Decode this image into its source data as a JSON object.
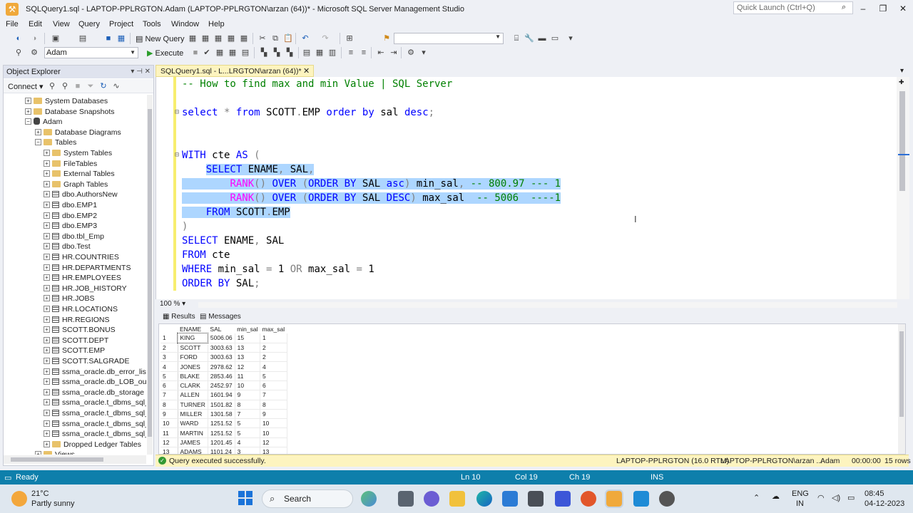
{
  "window": {
    "title": "SQLQuery1.sql - LAPTOP-PPLRGTON.Adam (LAPTOP-PPLRGTON\\arzan (64))* - Microsoft SQL Server Management Studio",
    "quick_launch_placeholder": "Quick Launch (Ctrl+Q)",
    "controls": [
      "–",
      "❐",
      "✕"
    ]
  },
  "menu": [
    "File",
    "Edit",
    "View",
    "Query",
    "Project",
    "Tools",
    "Window",
    "Help"
  ],
  "toolbar": {
    "new_query_label": "New Query",
    "database_selected": "Adam",
    "execute_label": "Execute"
  },
  "object_explorer": {
    "title": "Object Explorer",
    "connect_label": "Connect ▾",
    "tree": [
      {
        "label": "System Databases",
        "depth": 2,
        "icon": "folder",
        "expander": "+"
      },
      {
        "label": "Database Snapshots",
        "depth": 2,
        "icon": "folder",
        "expander": "+"
      },
      {
        "label": "Adam",
        "depth": 2,
        "icon": "database",
        "expander": "−"
      },
      {
        "label": "Database Diagrams",
        "depth": 3,
        "icon": "folder",
        "expander": "+"
      },
      {
        "label": "Tables",
        "depth": 3,
        "icon": "folder",
        "expander": "−"
      },
      {
        "label": "System Tables",
        "depth": 4,
        "icon": "folder",
        "expander": "+"
      },
      {
        "label": "FileTables",
        "depth": 4,
        "icon": "folder",
        "expander": "+"
      },
      {
        "label": "External Tables",
        "depth": 4,
        "icon": "folder",
        "expander": "+"
      },
      {
        "label": "Graph Tables",
        "depth": 4,
        "icon": "folder",
        "expander": "+"
      },
      {
        "label": "dbo.AuthorsNew",
        "depth": 4,
        "icon": "table",
        "expander": "+"
      },
      {
        "label": "dbo.EMP1",
        "depth": 4,
        "icon": "table",
        "expander": "+"
      },
      {
        "label": "dbo.EMP2",
        "depth": 4,
        "icon": "table",
        "expander": "+"
      },
      {
        "label": "dbo.EMP3",
        "depth": 4,
        "icon": "table",
        "expander": "+"
      },
      {
        "label": "dbo.tbl_Emp",
        "depth": 4,
        "icon": "table",
        "expander": "+"
      },
      {
        "label": "dbo.Test",
        "depth": 4,
        "icon": "table",
        "expander": "+"
      },
      {
        "label": "HR.COUNTRIES",
        "depth": 4,
        "icon": "table",
        "expander": "+"
      },
      {
        "label": "HR.DEPARTMENTS",
        "depth": 4,
        "icon": "table",
        "expander": "+"
      },
      {
        "label": "HR.EMPLOYEES",
        "depth": 4,
        "icon": "table",
        "expander": "+"
      },
      {
        "label": "HR.JOB_HISTORY",
        "depth": 4,
        "icon": "table",
        "expander": "+"
      },
      {
        "label": "HR.JOBS",
        "depth": 4,
        "icon": "table",
        "expander": "+"
      },
      {
        "label": "HR.LOCATIONS",
        "depth": 4,
        "icon": "table",
        "expander": "+"
      },
      {
        "label": "HR.REGIONS",
        "depth": 4,
        "icon": "table",
        "expander": "+"
      },
      {
        "label": "SCOTT.BONUS",
        "depth": 4,
        "icon": "table",
        "expander": "+"
      },
      {
        "label": "SCOTT.DEPT",
        "depth": 4,
        "icon": "table",
        "expander": "+"
      },
      {
        "label": "SCOTT.EMP",
        "depth": 4,
        "icon": "table",
        "expander": "+"
      },
      {
        "label": "SCOTT.SALGRADE",
        "depth": 4,
        "icon": "table",
        "expander": "+"
      },
      {
        "label": "ssma_oracle.db_error_list",
        "depth": 4,
        "icon": "table",
        "expander": "+"
      },
      {
        "label": "ssma_oracle.db_LOB_outp",
        "depth": 4,
        "icon": "table",
        "expander": "+"
      },
      {
        "label": "ssma_oracle.db_storage",
        "depth": 4,
        "icon": "table",
        "expander": "+"
      },
      {
        "label": "ssma_oracle.t_dbms_sql_b",
        "depth": 4,
        "icon": "table",
        "expander": "+"
      },
      {
        "label": "ssma_oracle.t_dbms_sql_c",
        "depth": 4,
        "icon": "table",
        "expander": "+"
      },
      {
        "label": "ssma_oracle.t_dbms_sql_d",
        "depth": 4,
        "icon": "table",
        "expander": "+"
      },
      {
        "label": "ssma_oracle.t_dbms_sql_re",
        "depth": 4,
        "icon": "table",
        "expander": "+"
      },
      {
        "label": "Dropped Ledger Tables",
        "depth": 4,
        "icon": "folder",
        "expander": "+"
      },
      {
        "label": "Views",
        "depth": 3,
        "icon": "folder",
        "expander": "+"
      }
    ]
  },
  "editor": {
    "tab_label": "SQLQuery1.sql - L...LRGTON\\arzan (64))*",
    "zoom": "100 %",
    "lines": [
      [
        {
          "t": "-- How to find max and min Value | SQL Server",
          "c": "cm"
        }
      ],
      [],
      [
        {
          "t": "select",
          "c": "kw"
        },
        {
          "t": " ",
          "c": ""
        },
        {
          "t": "*",
          "c": "gr"
        },
        {
          "t": " ",
          "c": ""
        },
        {
          "t": "from",
          "c": "kw"
        },
        {
          "t": " SCOTT",
          "c": ""
        },
        {
          "t": ".",
          "c": "gr"
        },
        {
          "t": "EMP ",
          "c": ""
        },
        {
          "t": "order by",
          "c": "kw"
        },
        {
          "t": " sal ",
          "c": ""
        },
        {
          "t": "desc",
          "c": "kw"
        },
        {
          "t": ";",
          "c": "gr"
        }
      ],
      [],
      [],
      [
        {
          "t": "WITH",
          "c": "kw"
        },
        {
          "t": " cte ",
          "c": ""
        },
        {
          "t": "AS",
          "c": "kw"
        },
        {
          "t": " ",
          "c": ""
        },
        {
          "t": "(",
          "c": "gr"
        }
      ],
      [
        {
          "t": "    ",
          "c": ""
        },
        {
          "t": "SELECT",
          "c": "kw sel"
        },
        {
          "t": " ENAME",
          "c": "sel"
        },
        {
          "t": ",",
          "c": "gr sel"
        },
        {
          "t": " SAL",
          "c": "sel"
        },
        {
          "t": ",",
          "c": "gr sel"
        }
      ],
      [
        {
          "t": "        ",
          "c": "sel"
        },
        {
          "t": "RANK",
          "c": "fn sel"
        },
        {
          "t": "()",
          "c": "gr sel"
        },
        {
          "t": " ",
          "c": "sel"
        },
        {
          "t": "OVER",
          "c": "kw sel"
        },
        {
          "t": " ",
          "c": "sel"
        },
        {
          "t": "(",
          "c": "gr sel"
        },
        {
          "t": "ORDER BY",
          "c": "kw sel"
        },
        {
          "t": " SAL ",
          "c": "sel"
        },
        {
          "t": "asc",
          "c": "kw sel"
        },
        {
          "t": ")",
          "c": "gr sel"
        },
        {
          "t": " min_sal",
          "c": "sel"
        },
        {
          "t": ",",
          "c": "gr sel"
        },
        {
          "t": " -- 800.97 --- 1",
          "c": "cm sel"
        }
      ],
      [
        {
          "t": "        ",
          "c": "sel"
        },
        {
          "t": "RANK",
          "c": "fn sel"
        },
        {
          "t": "()",
          "c": "gr sel"
        },
        {
          "t": " ",
          "c": "sel"
        },
        {
          "t": "OVER",
          "c": "kw sel"
        },
        {
          "t": " ",
          "c": "sel"
        },
        {
          "t": "(",
          "c": "gr sel"
        },
        {
          "t": "ORDER BY",
          "c": "kw sel"
        },
        {
          "t": " SAL ",
          "c": "sel"
        },
        {
          "t": "DESC",
          "c": "kw sel"
        },
        {
          "t": ")",
          "c": "gr sel"
        },
        {
          "t": " max_sal  ",
          "c": "sel"
        },
        {
          "t": "-- 5006  ----1",
          "c": "cm sel"
        }
      ],
      [
        {
          "t": "    ",
          "c": "sel"
        },
        {
          "t": "FROM",
          "c": "kw sel"
        },
        {
          "t": " SCOTT",
          "c": "sel"
        },
        {
          "t": ".",
          "c": "gr sel"
        },
        {
          "t": "EMP",
          "c": "sel"
        }
      ],
      [
        {
          "t": ")",
          "c": "gr"
        }
      ],
      [
        {
          "t": "SELECT",
          "c": "kw"
        },
        {
          "t": " ENAME",
          "c": ""
        },
        {
          "t": ",",
          "c": "gr"
        },
        {
          "t": " SAL",
          "c": ""
        }
      ],
      [
        {
          "t": "FROM",
          "c": "kw"
        },
        {
          "t": " cte",
          "c": ""
        }
      ],
      [
        {
          "t": "WHERE",
          "c": "kw"
        },
        {
          "t": " min_sal ",
          "c": ""
        },
        {
          "t": "=",
          "c": "gr"
        },
        {
          "t": " 1 ",
          "c": ""
        },
        {
          "t": "OR",
          "c": "gr"
        },
        {
          "t": " max_sal ",
          "c": ""
        },
        {
          "t": "=",
          "c": "gr"
        },
        {
          "t": " 1",
          "c": ""
        }
      ],
      [
        {
          "t": "ORDER BY",
          "c": "kw"
        },
        {
          "t": " SAL",
          "c": ""
        },
        {
          "t": ";",
          "c": "gr"
        }
      ]
    ]
  },
  "results": {
    "tabs": [
      "Results",
      "Messages"
    ],
    "columns": [
      "ENAME",
      "SAL",
      "min_sal",
      "max_sal"
    ],
    "rows": [
      [
        "1",
        "KING",
        "5006.06",
        "15",
        "1"
      ],
      [
        "2",
        "SCOTT",
        "3003.63",
        "13",
        "2"
      ],
      [
        "3",
        "FORD",
        "3003.63",
        "13",
        "2"
      ],
      [
        "4",
        "JONES",
        "2978.62",
        "12",
        "4"
      ],
      [
        "5",
        "BLAKE",
        "2853.46",
        "11",
        "5"
      ],
      [
        "6",
        "CLARK",
        "2452.97",
        "10",
        "6"
      ],
      [
        "7",
        "ALLEN",
        "1601.94",
        "9",
        "7"
      ],
      [
        "8",
        "TURNER",
        "1501.82",
        "8",
        "8"
      ],
      [
        "9",
        "MILLER",
        "1301.58",
        "7",
        "9"
      ],
      [
        "10",
        "WARD",
        "1251.52",
        "5",
        "10"
      ],
      [
        "11",
        "MARTIN",
        "1251.52",
        "5",
        "10"
      ],
      [
        "12",
        "JAMES",
        "1201.45",
        "4",
        "12"
      ],
      [
        "13",
        "ADAMS",
        "1101.24",
        "3",
        "13"
      ]
    ]
  },
  "query_status": {
    "message": "Query executed successfully.",
    "server": "LAPTOP-PPLRGTON (16.0 RTM)",
    "user": "LAPTOP-PPLRGTON\\arzan ...",
    "database": "Adam",
    "elapsed": "00:00:00",
    "rows": "15 rows"
  },
  "status_bar": {
    "state": "Ready",
    "line": "Ln 10",
    "col": "Col 19",
    "ch": "Ch 19",
    "mode": "INS"
  },
  "taskbar": {
    "temperature": "21°C",
    "weather": "Partly sunny",
    "search_label": "Search",
    "language_top": "ENG",
    "language_bottom": "IN",
    "time": "08:45",
    "date": "04-12-2023"
  },
  "colors": {
    "accent": "#0e7fab",
    "selection": "#add6ff",
    "tab_yellow": "#fdf4bf"
  }
}
